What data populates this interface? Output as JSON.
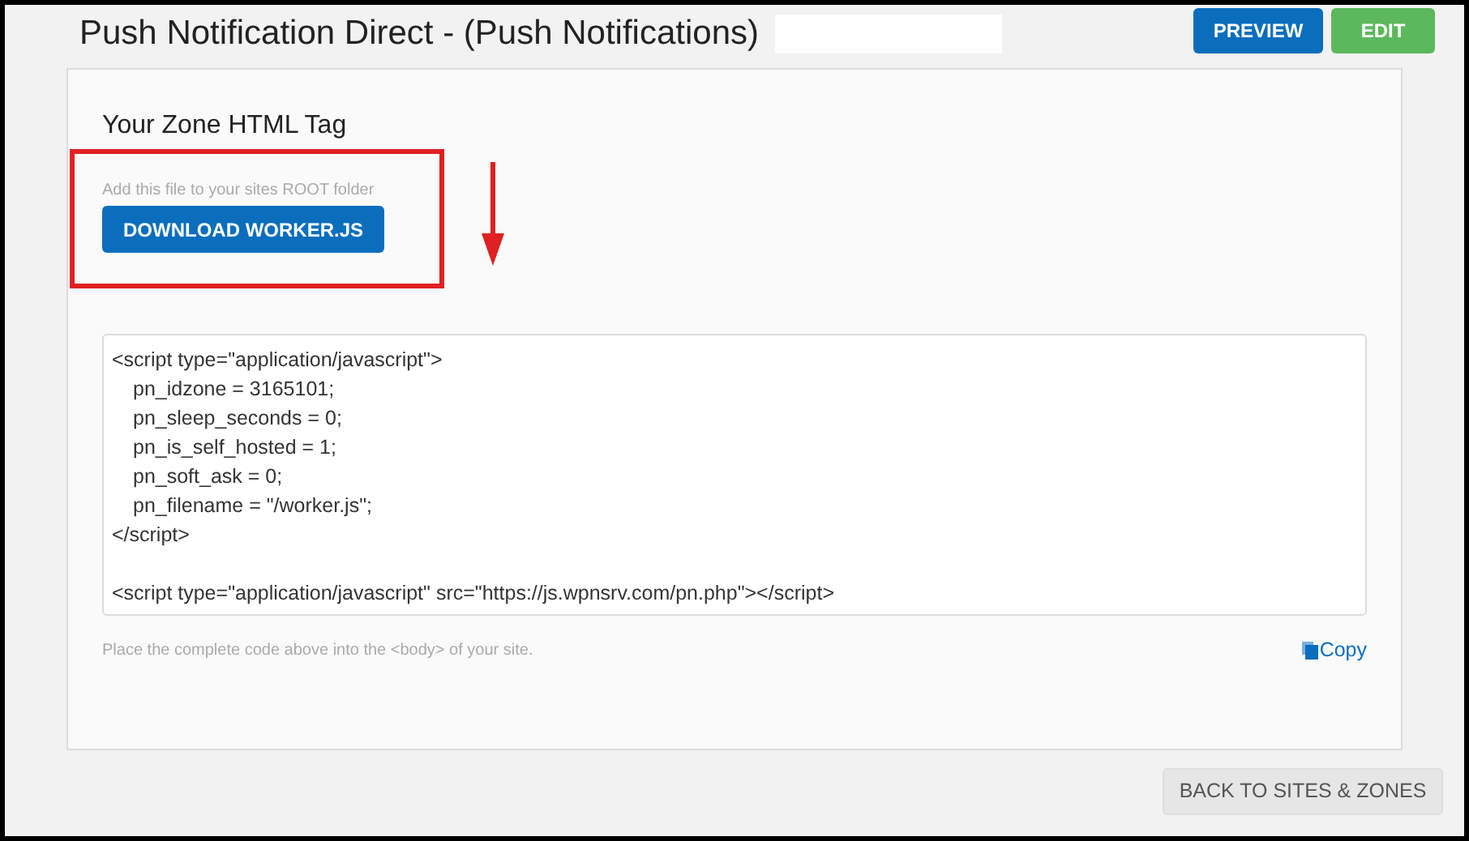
{
  "header": {
    "title": "Push Notification Direct - (Push Notifications)",
    "buttons": [
      {
        "label": "PREVIEW",
        "kind": "primary"
      },
      {
        "label": "EDIT",
        "kind": "success"
      }
    ]
  },
  "card": {
    "heading": "Your Zone HTML Tag",
    "hint": "Add this file to your sites ROOT folder",
    "download_button": "DOWNLOAD WORKER.JS",
    "code_blocks": [
      [
        {
          "text": "<script type=\"application/javascript\">",
          "indented": false
        },
        {
          "text": "pn_idzone = 3165101;",
          "indented": true
        },
        {
          "text": "pn_sleep_seconds = 0;",
          "indented": true
        },
        {
          "text": "pn_is_self_hosted = 1;",
          "indented": true
        },
        {
          "text": "pn_soft_ask = 0;",
          "indented": true
        },
        {
          "text": "pn_filename = \"/worker.js\";",
          "indented": true
        },
        {
          "text": "</script>",
          "indented": false
        }
      ],
      [
        {
          "text": "<script type=\"application/javascript\" src=\"https://js.wpnsrv.com/pn.php\"></script>",
          "indented": false
        }
      ]
    ],
    "footer_note": "Place the complete code above into the <body> of your site.",
    "copy_link": "Copy"
  },
  "back_button": "BACK TO SITES & ZONES"
}
